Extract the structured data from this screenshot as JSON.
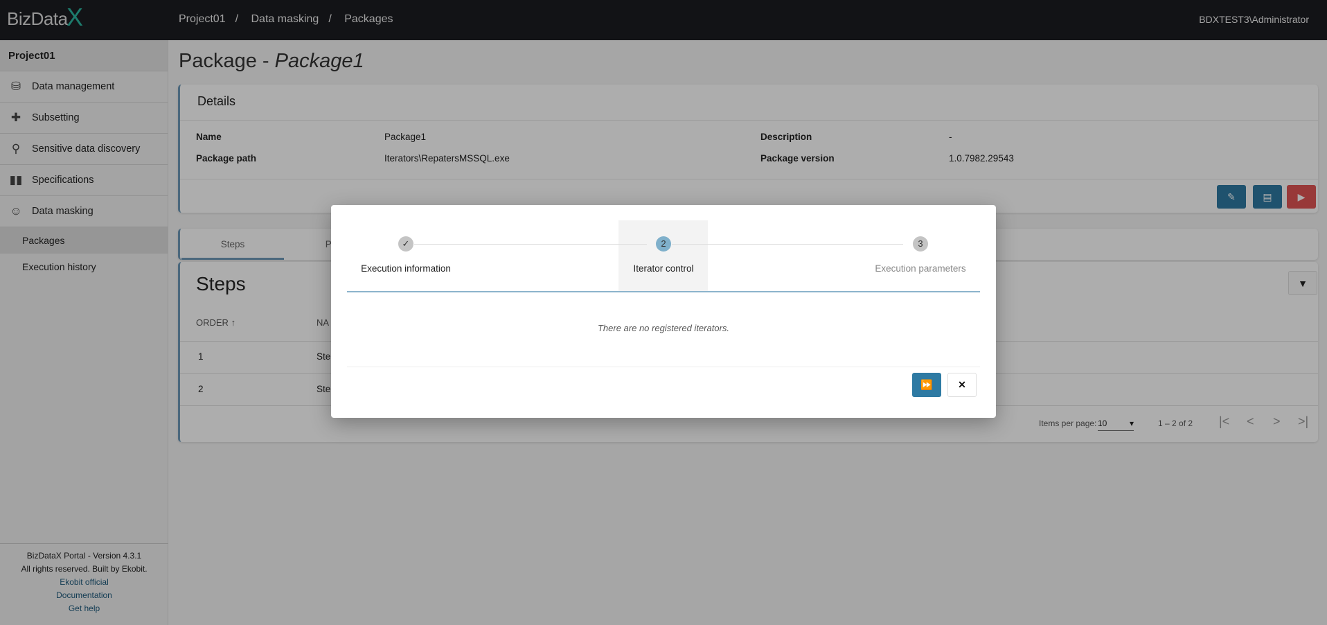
{
  "header": {
    "logo": "BizDataX",
    "breadcrumb": [
      "Project01",
      "Data masking",
      "Packages"
    ],
    "user": "BDXTEST3\\Administrator"
  },
  "sidebar": {
    "project": "Project01",
    "items": [
      {
        "label": "Data management",
        "icon": "database-icon"
      },
      {
        "label": "Subsetting",
        "icon": "puzzle-icon"
      },
      {
        "label": "Sensitive data discovery",
        "icon": "search-icon"
      },
      {
        "label": "Specifications",
        "icon": "book-icon"
      },
      {
        "label": "Data masking",
        "icon": "masks-icon"
      }
    ],
    "subitems": [
      {
        "label": "Packages",
        "active": true
      },
      {
        "label": "Execution history"
      }
    ],
    "footer": {
      "version": "BizDataX Portal - Version 4.3.1",
      "rights": "All rights reserved. Built by Ekobit.",
      "links": [
        "Ekobit official",
        "Documentation",
        "Get help"
      ]
    }
  },
  "page": {
    "title_prefix": "Package - ",
    "title_name": "Package1"
  },
  "details": {
    "title": "Details",
    "name_label": "Name",
    "name": "Package1",
    "path_label": "Package path",
    "path": "Iterators\\RepatersMSSQL.exe",
    "desc_label": "Description",
    "desc": "-",
    "version_label": "Package version",
    "version": "1.0.7982.29543"
  },
  "tabs": [
    "Steps",
    "Para"
  ],
  "steps": {
    "title": "Steps",
    "columns": [
      "ORDER",
      "NA"
    ],
    "rows": [
      {
        "order": "1",
        "name": "Ste"
      },
      {
        "order": "2",
        "name": "Ste"
      }
    ],
    "items_per_page_label": "Items per page:",
    "items_per_page": "10",
    "range": "1 – 2 of 2"
  },
  "modal": {
    "steps": [
      {
        "marker": "✓",
        "label": "Execution information"
      },
      {
        "marker": "2",
        "label": "Iterator control"
      },
      {
        "marker": "3",
        "label": "Execution parameters"
      }
    ],
    "message": "There are no registered iterators."
  },
  "colors": {
    "primary": "#2e7aa3",
    "danger": "#e05555",
    "header": "#1b1c21"
  }
}
